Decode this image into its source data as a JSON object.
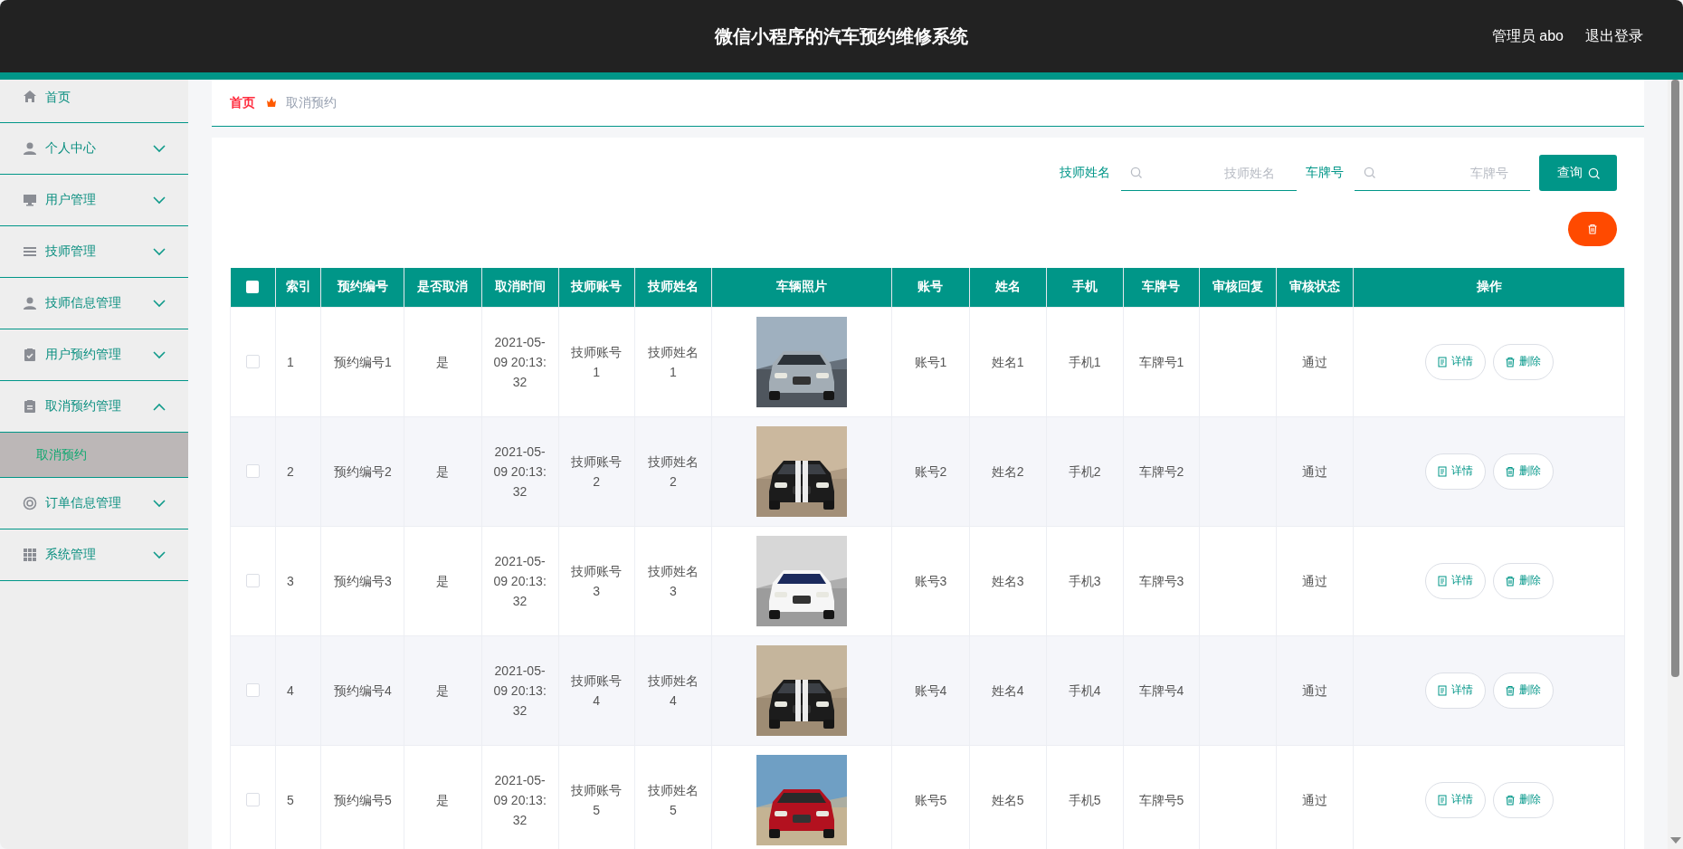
{
  "header": {
    "title": "微信小程序的汽车预约维修系统",
    "user": "管理员 abo",
    "logout": "退出登录"
  },
  "sidebar": {
    "items": [
      {
        "kind": "link",
        "label": "首页"
      },
      {
        "kind": "menu",
        "label": "个人中心",
        "expanded": false
      },
      {
        "kind": "menu",
        "label": "用户管理",
        "expanded": false
      },
      {
        "kind": "menu",
        "label": "技师管理",
        "expanded": false
      },
      {
        "kind": "menu",
        "label": "技师信息管理",
        "expanded": false
      },
      {
        "kind": "menu",
        "label": "用户预约管理",
        "expanded": false
      },
      {
        "kind": "menu",
        "label": "取消预约管理",
        "expanded": true,
        "children": [
          {
            "label": "取消预约",
            "selected": true
          }
        ]
      },
      {
        "kind": "menu",
        "label": "订单信息管理",
        "expanded": false
      },
      {
        "kind": "menu",
        "label": "系统管理",
        "expanded": false
      }
    ]
  },
  "breadcrumb": [
    {
      "label": "首页",
      "current": false
    },
    {
      "label": "取消预约",
      "current": true
    }
  ],
  "search": {
    "fields": [
      {
        "label": "技师姓名",
        "placeholder": "技师姓名"
      },
      {
        "label": "车牌号",
        "placeholder": "车牌号"
      }
    ],
    "button": "查询"
  },
  "table": {
    "select_all": {
      "checked": false
    },
    "columns": [
      "索引",
      "预约编号",
      "是否取消",
      "取消时间",
      "技师账号",
      "技师姓名",
      "车辆照片",
      "账号",
      "姓名",
      "手机",
      "车牌号",
      "审核回复",
      "审核状态",
      "操作"
    ],
    "rows": [
      {
        "checked": false,
        "index": "1",
        "booking_no": "预约编号1",
        "cancelled": "是",
        "cancel_time": "2021-05-09 20:13:32",
        "tech_account": "技师账号1",
        "tech_name": "技师姓名1",
        "account": "账号1",
        "name": "姓名1",
        "phone": "手机1",
        "plate": "车牌号1",
        "review_status": "通过",
        "actions": [
          {
            "kind": "detail",
            "label": "详情"
          },
          {
            "kind": "delete",
            "label": "删除"
          }
        ]
      },
      {
        "checked": false,
        "index": "2",
        "booking_no": "预约编号2",
        "cancelled": "是",
        "cancel_time": "2021-05-09 20:13:32",
        "tech_account": "技师账号2",
        "tech_name": "技师姓名2",
        "account": "账号2",
        "name": "姓名2",
        "phone": "手机2",
        "plate": "车牌号2",
        "review_status": "通过",
        "actions": [
          {
            "kind": "detail",
            "label": "详情"
          },
          {
            "kind": "delete",
            "label": "删除"
          }
        ]
      },
      {
        "checked": false,
        "index": "3",
        "booking_no": "预约编号3",
        "cancelled": "是",
        "cancel_time": "2021-05-09 20:13:32",
        "tech_account": "技师账号3",
        "tech_name": "技师姓名3",
        "account": "账号3",
        "name": "姓名3",
        "phone": "手机3",
        "plate": "车牌号3",
        "review_status": "通过",
        "actions": [
          {
            "kind": "detail",
            "label": "详情"
          },
          {
            "kind": "delete",
            "label": "删除"
          }
        ]
      },
      {
        "checked": false,
        "index": "4",
        "booking_no": "预约编号4",
        "cancelled": "是",
        "cancel_time": "2021-05-09 20:13:32",
        "tech_account": "技师账号4",
        "tech_name": "技师姓名4",
        "account": "账号4",
        "name": "姓名4",
        "phone": "手机4",
        "plate": "车牌号4",
        "review_status": "通过",
        "actions": [
          {
            "kind": "detail",
            "label": "详情"
          },
          {
            "kind": "delete",
            "label": "删除"
          }
        ]
      },
      {
        "checked": false,
        "index": "5",
        "booking_no": "预约编号5",
        "cancelled": "是",
        "cancel_time": "2021-05-09 20:13:32",
        "tech_account": "技师账号5",
        "tech_name": "技师姓名5",
        "account": "账号5",
        "name": "姓名5",
        "phone": "手机5",
        "plate": "车牌号5",
        "review_status": "通过",
        "actions": [
          {
            "kind": "detail",
            "label": "详情"
          },
          {
            "kind": "delete",
            "label": "删除"
          }
        ]
      }
    ]
  }
}
